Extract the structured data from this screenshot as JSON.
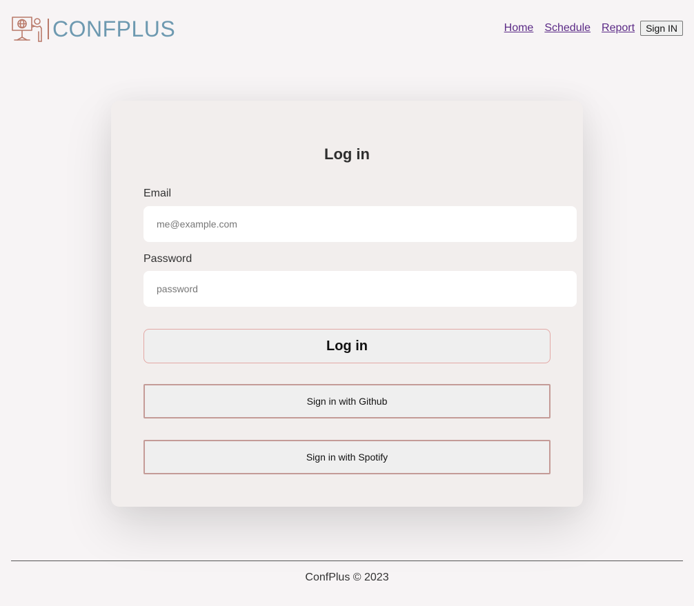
{
  "brand": {
    "name": "CONFPLUS",
    "logo_icon": "presenter-at-podium-icon"
  },
  "nav": {
    "items": [
      {
        "label": "Home"
      },
      {
        "label": "Schedule"
      },
      {
        "label": "Report"
      }
    ],
    "signin_label": "Sign IN"
  },
  "login": {
    "title": "Log in",
    "email_label": "Email",
    "email_placeholder": "me@example.com",
    "email_value": "",
    "password_label": "Password",
    "password_placeholder": "password",
    "password_value": "",
    "submit_label": "Log in",
    "github_label": "Sign in with Github",
    "spotify_label": "Sign in with Spotify"
  },
  "footer": {
    "text": "ConfPlus © 2023"
  },
  "colors": {
    "background": "#f7f4f5",
    "brand_text": "#6d99b0",
    "brand_icon": "#b97a6a",
    "link": "#5b2a86",
    "card": "#f2eeed",
    "login_border": "#e3a8a5",
    "oauth_border": "#c49b97"
  }
}
